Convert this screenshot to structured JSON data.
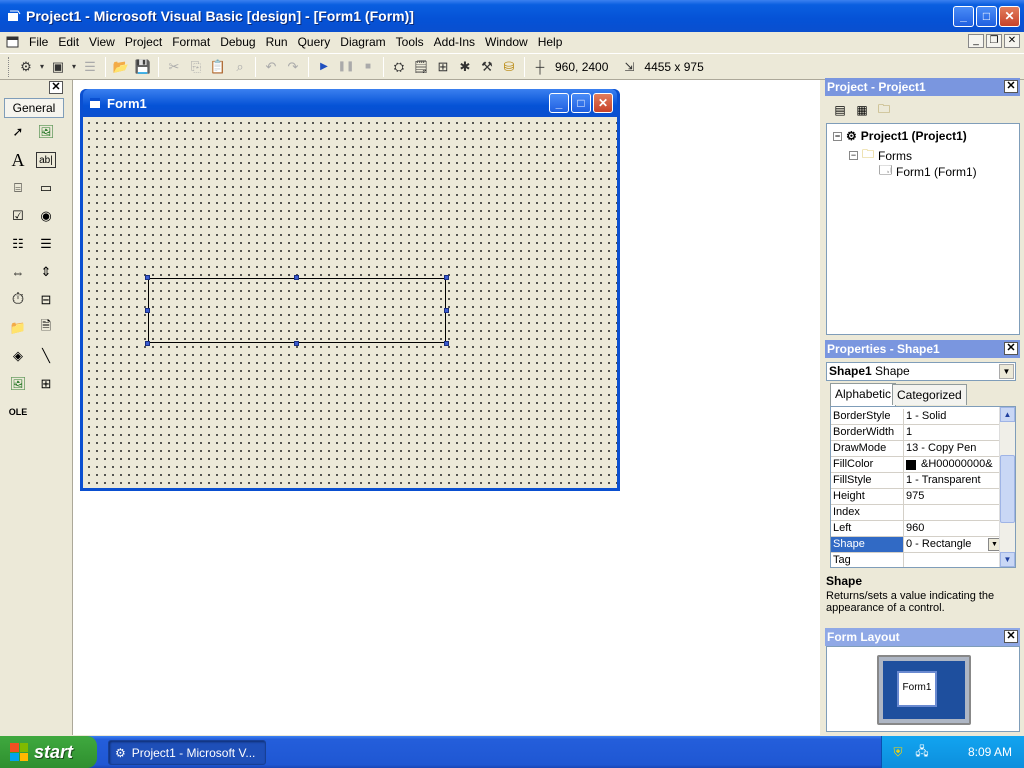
{
  "window": {
    "title": "Project1 - Microsoft Visual Basic [design] - [Form1 (Form)]"
  },
  "menu": [
    "File",
    "Edit",
    "View",
    "Project",
    "Format",
    "Debug",
    "Run",
    "Query",
    "Diagram",
    "Tools",
    "Add-Ins",
    "Window",
    "Help"
  ],
  "toolbar": {
    "position": "960, 2400",
    "size": "4455 x 975"
  },
  "toolbox": {
    "tab_label": "General"
  },
  "form": {
    "title": "Form1"
  },
  "project": {
    "title": "Project - Project1",
    "root": "Project1 (Project1)",
    "folder": "Forms",
    "item": "Form1 (Form1)"
  },
  "properties": {
    "title": "Properties - Shape1",
    "object_name": "Shape1",
    "object_type": "Shape",
    "tabs": [
      "Alphabetic",
      "Categorized"
    ],
    "rows": [
      {
        "name": "BorderStyle",
        "value": "1 - Solid"
      },
      {
        "name": "BorderWidth",
        "value": "1"
      },
      {
        "name": "DrawMode",
        "value": "13 - Copy Pen"
      },
      {
        "name": "FillColor",
        "value": "&H00000000&"
      },
      {
        "name": "FillStyle",
        "value": "1 - Transparent"
      },
      {
        "name": "Height",
        "value": "975"
      },
      {
        "name": "Index",
        "value": ""
      },
      {
        "name": "Left",
        "value": "960"
      },
      {
        "name": "Shape",
        "value": "0 - Rectangle"
      },
      {
        "name": "Tag",
        "value": ""
      }
    ],
    "selected": "Shape",
    "desc_title": "Shape",
    "desc_text": "Returns/sets a value indicating the appearance of a control."
  },
  "form_layout": {
    "title": "Form Layout",
    "preview_label": "Form1"
  },
  "taskbar": {
    "start": "start",
    "task_button": "Project1 - Microsoft V...",
    "clock": "8:09 AM"
  }
}
